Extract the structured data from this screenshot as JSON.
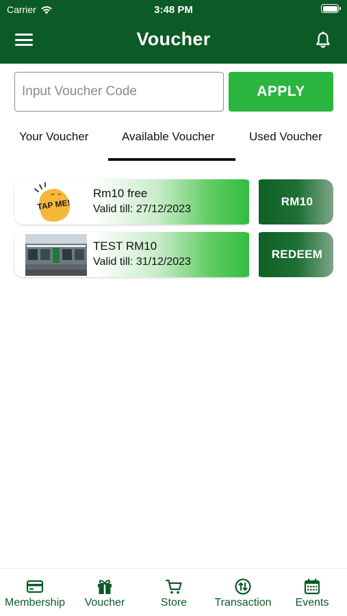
{
  "status_bar": {
    "carrier": "Carrier",
    "time": "3:48 PM"
  },
  "header": {
    "title": "Voucher",
    "menu_icon": "hamburger-menu-icon",
    "notification_icon": "bell-icon",
    "color": "#0c5a25"
  },
  "voucher_entry": {
    "placeholder": "Input Voucher Code",
    "value": "",
    "apply_label": "APPLY",
    "apply_color": "#2ab63e"
  },
  "tabs": {
    "items": [
      {
        "label": "Your Voucher"
      },
      {
        "label": "Available Voucher"
      },
      {
        "label": "Used Voucher"
      }
    ],
    "active": "Available Voucher"
  },
  "vouchers": [
    {
      "title": "Rm10 free",
      "valid": "Valid till: 27/12/2023",
      "action_label": "RM10",
      "image": "tap-me-mascot-image",
      "image_text": "TAP ME!"
    },
    {
      "title": "TEST RM10",
      "valid": "Valid till: 31/12/2023",
      "action_label": "REDEEM",
      "image": "storefront-photo"
    }
  ],
  "bottom_nav": {
    "items": [
      {
        "label": "Membership",
        "icon": "membership-card-icon"
      },
      {
        "label": "Voucher",
        "icon": "gift-icon"
      },
      {
        "label": "Store",
        "icon": "shopping-cart-icon"
      },
      {
        "label": "Transaction",
        "icon": "transaction-arrows-icon"
      },
      {
        "label": "Events",
        "icon": "calendar-icon"
      }
    ],
    "color": "#0c5a25"
  }
}
